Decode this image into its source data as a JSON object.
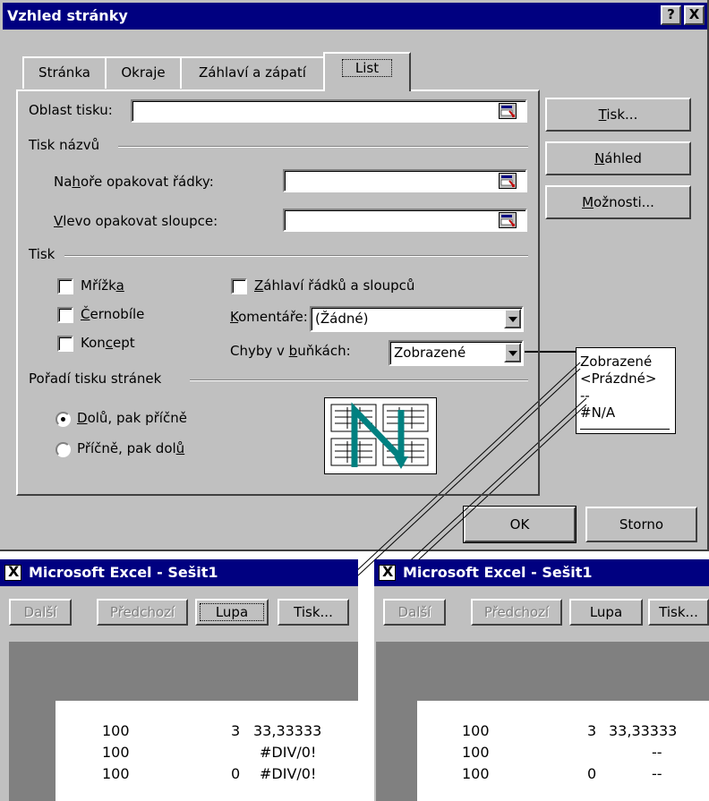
{
  "dialog": {
    "title": "Vzhled stránky",
    "help_btn": "?",
    "close_btn": "X",
    "tabs": [
      "Stránka",
      "Okraje",
      "Záhlaví a zápatí",
      "List"
    ],
    "print_area_label": "Oblast tisku:",
    "print_titles_group": "Tisk názvů",
    "rows_repeat_label": "Nahoře opakovat řádky:",
    "cols_repeat_label": "Vlevo opakovat sloupce:",
    "print_group": "Tisk",
    "gridlines_label": "Mřížka",
    "bw_label": "Černobíle",
    "draft_label": "Koncept",
    "headings_label": "Záhlaví řádků a sloupců",
    "comments_label": "Komentáře:",
    "comments_value": "(Žádné)",
    "errors_label": "Chyby v buňkách:",
    "errors_value": "Zobrazené",
    "page_order_group": "Pořadí tisku stránek",
    "down_then_over": "Dolů, pak příčně",
    "over_then_down": "Příčně, pak dolů",
    "btn_print": "Tisk...",
    "btn_preview": "Náhled",
    "btn_options": "Možnosti...",
    "btn_ok": "OK",
    "btn_cancel": "Storno"
  },
  "error_options": [
    "Zobrazené",
    "<Prázdné>",
    "--",
    "#N/A"
  ],
  "excel_left": {
    "title": "Microsoft Excel - Sešit1",
    "toolbar": [
      "Další",
      "Předchozí",
      "Lupa",
      "Tisk..."
    ],
    "rows": [
      [
        "100",
        "3",
        "33,33333"
      ],
      [
        "100",
        "",
        "#DIV/0!"
      ],
      [
        "100",
        "0",
        "#DIV/0!"
      ]
    ]
  },
  "excel_right": {
    "title": "Microsoft Excel - Sešit1",
    "toolbar": [
      "Další",
      "Předchozí",
      "Lupa",
      "Tisk..."
    ],
    "rows": [
      [
        "100",
        "3",
        "33,33333"
      ],
      [
        "100",
        "",
        "--"
      ],
      [
        "100",
        "0",
        "--"
      ]
    ]
  },
  "colors": {
    "titlebar": "#000080",
    "face": "#c0c0c0",
    "teal": "#008080"
  }
}
